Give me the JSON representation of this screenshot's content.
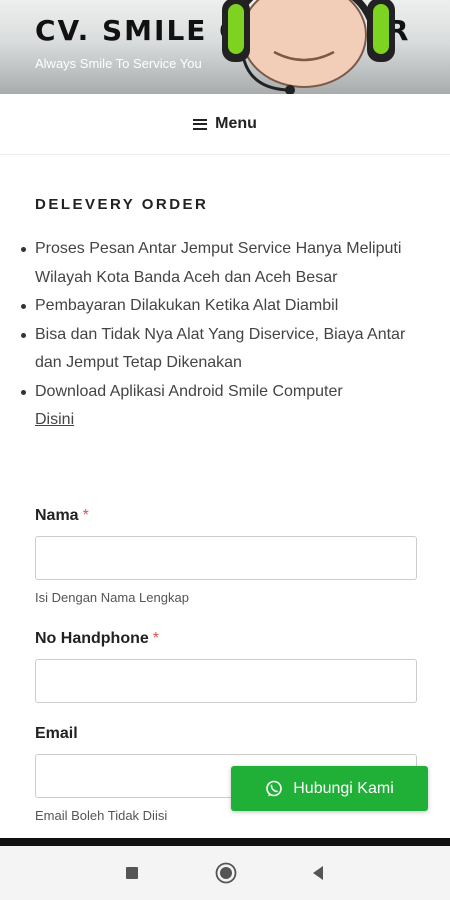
{
  "header": {
    "site_title": "CV. SMILE COMPUTER",
    "tagline": "Always Smile To Service You"
  },
  "menu": {
    "label": "Menu",
    "icon": "hamburger-icon"
  },
  "section": {
    "title": "DELEVERY ORDER",
    "items": [
      "Proses Pesan Antar Jemput Service Hanya Meliputi Wilayah Kota Banda Aceh dan Aceh Besar",
      "Pembayaran Dilakukan Ketika Alat Diambil",
      "Bisa dan Tidak Nya Alat Yang Diservice, Biaya Antar dan Jemput Tetap Dikenakan",
      "Download Aplikasi Android Smile Computer"
    ],
    "download_link": "Disini"
  },
  "form": {
    "nama": {
      "label": "Nama",
      "required": "*",
      "value": "",
      "hint": "Isi Dengan Nama Lengkap"
    },
    "phone": {
      "label": "No Handphone",
      "required": "*",
      "value": ""
    },
    "email": {
      "label": "Email",
      "value": "",
      "hint": "Email Boleh Tidak Diisi"
    }
  },
  "whatsapp_button": {
    "label": "Hubungi Kami",
    "icon": "whatsapp-icon",
    "color": "#20b038"
  },
  "android_nav": {
    "icons": [
      "recents-icon",
      "home-icon",
      "back-icon"
    ]
  }
}
